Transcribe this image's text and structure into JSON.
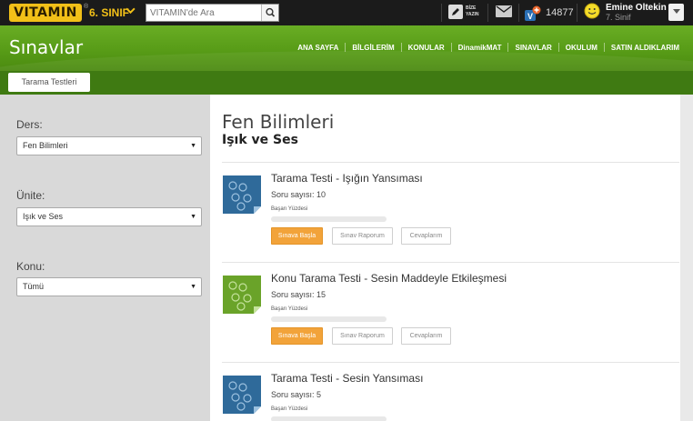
{
  "topbar": {
    "logo_text": "VITAMIN",
    "logo_reg": "®",
    "grade_label": "6. SINIF",
    "search_placeholder": "VİTAMİN'de Ara",
    "bize_label_1": "BİZE",
    "bize_label_2": "YAZIN",
    "points": "14877",
    "user_name": "Emine Oltekin",
    "user_grade": "7. Sinif"
  },
  "header": {
    "title": "Sınavlar",
    "nav": [
      "ANA SAYFA",
      "BİLGİLERİM",
      "KONULAR",
      "DinamikMAT",
      "SINAVLAR",
      "OKULUM",
      "SATIN ALDIKLARIM"
    ]
  },
  "tabs": {
    "active": "Tarama Testleri"
  },
  "filters": {
    "ders_label": "Ders:",
    "ders_value": "Fen Bilimleri",
    "unite_label": "Ünite:",
    "unite_value": "Işık ve Ses",
    "konu_label": "Konu:",
    "konu_value": "Tümü"
  },
  "main": {
    "subject": "Fen Bilimleri",
    "unit": "Işık ve Ses",
    "tests": [
      {
        "title": "Tarama Testi - Işığın Yansıması",
        "count": "Soru sayısı: 10",
        "success_label": "Başarı Yüzdesi",
        "success": 0,
        "thumb_color": "#2f6a9a",
        "start": "Sınava Başla",
        "report": "Sınav Raporum",
        "answers": "Cevaplarım"
      },
      {
        "title": "Konu Tarama Testi - Sesin Maddeyle Etkileşmesi",
        "count": "Soru sayısı: 15",
        "success_label": "Başarı Yüzdesi",
        "success": 0,
        "thumb_color": "#6aa329",
        "start": "Sınava Başla",
        "report": "Sınav Raporum",
        "answers": "Cevaplarım"
      },
      {
        "title": "Tarama Testi - Sesin Yansıması",
        "count": "Soru sayısı: 5",
        "success_label": "Başarı Yüzdesi",
        "success": 0,
        "thumb_color": "#2f6a9a"
      }
    ]
  },
  "colors": {
    "header_green": "#5fa31c",
    "tab_green": "#3f7a12",
    "start_orange": "#f2a33a",
    "topbar_bg": "#1b1b1b",
    "logo_yellow": "#f2c018"
  }
}
